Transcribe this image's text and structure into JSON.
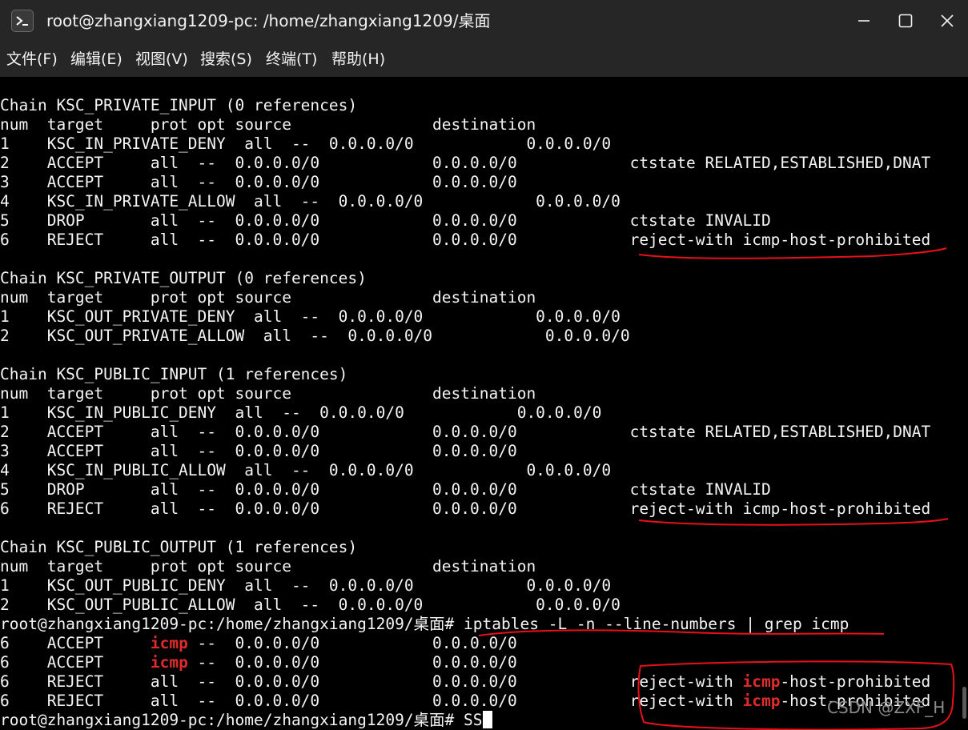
{
  "window": {
    "title": "root@zhangxiang1209-pc: /home/zhangxiang1209/桌面",
    "minimize_icon": "minimize-icon",
    "maximize_icon": "maximize-icon",
    "close_icon": "close-icon",
    "app_icon": "terminal-icon"
  },
  "menu": [
    "文件(F)",
    "编辑(E)",
    "视图(V)",
    "搜索(S)",
    "终端(T)",
    "帮助(H)"
  ],
  "terminal": {
    "lines": [
      "Chain KSC_PRIVATE_INPUT (0 references)",
      "num  target     prot opt source               destination",
      "1    KSC_IN_PRIVATE_DENY  all  --  0.0.0.0/0            0.0.0.0/0",
      "2    ACCEPT     all  --  0.0.0.0/0            0.0.0.0/0            ctstate RELATED,ESTABLISHED,DNAT",
      "3    ACCEPT     all  --  0.0.0.0/0            0.0.0.0/0",
      "4    KSC_IN_PRIVATE_ALLOW  all  --  0.0.0.0/0            0.0.0.0/0",
      "5    DROP       all  --  0.0.0.0/0            0.0.0.0/0            ctstate INVALID",
      "6    REJECT     all  --  0.0.0.0/0            0.0.0.0/0            reject-with icmp-host-prohibited",
      "",
      "Chain KSC_PRIVATE_OUTPUT (0 references)",
      "num  target     prot opt source               destination",
      "1    KSC_OUT_PRIVATE_DENY  all  --  0.0.0.0/0            0.0.0.0/0",
      "2    KSC_OUT_PRIVATE_ALLOW  all  --  0.0.0.0/0            0.0.0.0/0",
      "",
      "Chain KSC_PUBLIC_INPUT (1 references)",
      "num  target     prot opt source               destination",
      "1    KSC_IN_PUBLIC_DENY  all  --  0.0.0.0/0            0.0.0.0/0",
      "2    ACCEPT     all  --  0.0.0.0/0            0.0.0.0/0            ctstate RELATED,ESTABLISHED,DNAT",
      "3    ACCEPT     all  --  0.0.0.0/0            0.0.0.0/0",
      "4    KSC_IN_PUBLIC_ALLOW  all  --  0.0.0.0/0            0.0.0.0/0",
      "5    DROP       all  --  0.0.0.0/0            0.0.0.0/0            ctstate INVALID",
      "6    REJECT     all  --  0.0.0.0/0            0.0.0.0/0            reject-with icmp-host-prohibited",
      "",
      "Chain KSC_PUBLIC_OUTPUT (1 references)",
      "num  target     prot opt source               destination",
      "1    KSC_OUT_PUBLIC_DENY  all  --  0.0.0.0/0            0.0.0.0/0",
      "2    KSC_OUT_PUBLIC_ALLOW  all  --  0.0.0.0/0            0.0.0.0/0",
      "root@zhangxiang1209-pc:/home/zhangxiang1209/桌面# iptables -L -n --line-numbers | grep icmp",
      "6    ACCEPT     icmp --  0.0.0.0/0            0.0.0.0/0",
      "6    ACCEPT     icmp --  0.0.0.0/0            0.0.0.0/0",
      "6    REJECT     all  --  0.0.0.0/0            0.0.0.0/0            reject-with icmp-host-prohibited",
      "6    REJECT     all  --  0.0.0.0/0            0.0.0.0/0            reject-with icmp-host-prohibited",
      "root@zhangxiang1209-pc:/home/zhangxiang1209/桌面# SS"
    ],
    "highlight_word": "icmp",
    "highlight_color": "#e02b2b",
    "annotation_color": "#e8101a"
  },
  "watermark": "CSDN @ZXF_H"
}
